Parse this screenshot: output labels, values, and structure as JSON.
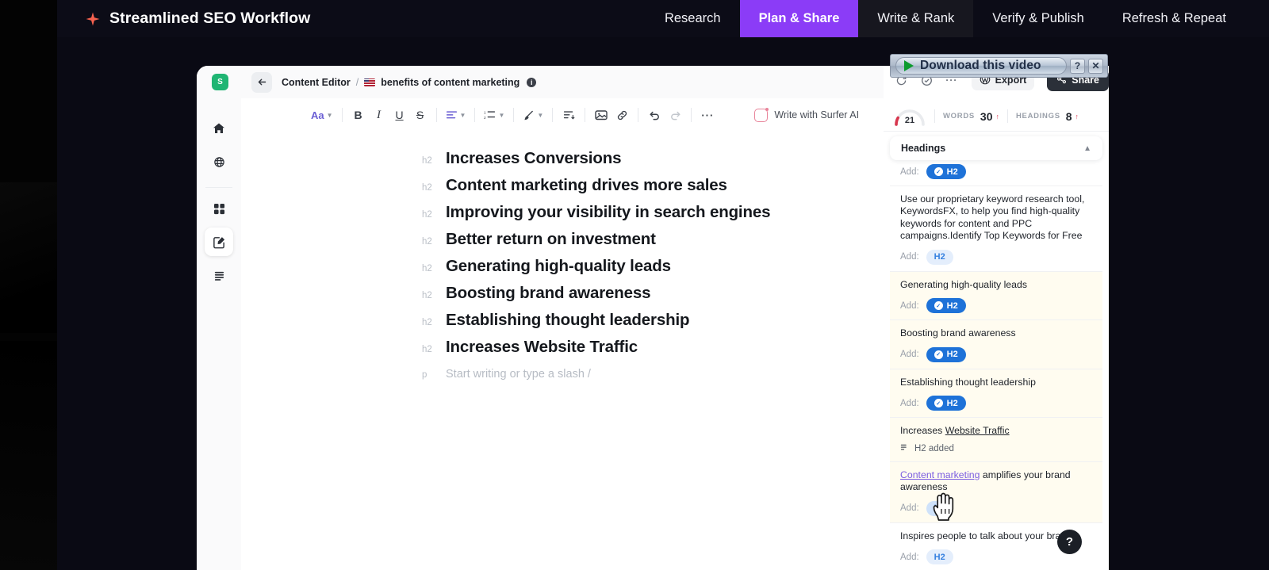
{
  "topnav": {
    "brand_title": "Streamlined SEO Workflow",
    "brand_icon": "sparkle-icon",
    "accent_color": "#8b3cf7",
    "brand_icon_color": "#f4614f",
    "tabs": [
      {
        "label": "Research",
        "active": false
      },
      {
        "label": "Plan & Share",
        "active": true
      },
      {
        "label": "Write & Rank",
        "active": false
      },
      {
        "label": "Verify & Publish",
        "active": false
      },
      {
        "label": "Refresh & Repeat",
        "active": false
      }
    ]
  },
  "app": {
    "logo_letter": "S",
    "breadcrumb": {
      "root": "Content Editor",
      "separator": "/",
      "flag": "us-flag-icon",
      "current": "benefits of content marketing",
      "info": "i"
    },
    "rail": [
      {
        "name": "home-icon"
      },
      {
        "name": "globe-icon"
      },
      {
        "name": "grid-icon"
      },
      {
        "name": "content-editor-icon",
        "active": true
      },
      {
        "name": "list-icon"
      }
    ]
  },
  "toolbar": {
    "font_size_label": "Aa",
    "bold": "B",
    "italic": "I",
    "underline": "U",
    "strikethrough": "S",
    "align": "align-icon",
    "ordered_list": "ordered-list-icon",
    "highlight": "brush-icon",
    "indent": "indent-icon",
    "image": "image-icon",
    "link": "link-icon",
    "undo": "undo-icon",
    "redo": "redo-icon",
    "more": "···",
    "ai_label": "Write with Surfer AI"
  },
  "document": {
    "blocks": [
      {
        "tag": "h2",
        "text": "Increases Conversions"
      },
      {
        "tag": "h2",
        "text": "Content marketing drives more sales"
      },
      {
        "tag": "h2",
        "text": "Improving your visibility in search engines"
      },
      {
        "tag": "h2",
        "text": "Better return on investment"
      },
      {
        "tag": "h2",
        "text": "Generating high-quality leads"
      },
      {
        "tag": "h2",
        "text": "Boosting brand awareness"
      },
      {
        "tag": "h2",
        "text": "Establishing thought leadership"
      },
      {
        "tag": "h2",
        "text": "Increases Website Traffic"
      }
    ],
    "empty_tag": "p",
    "empty_placeholder": "Start writing or type a slash /"
  },
  "panel": {
    "actions": {
      "refresh": "refresh-icon",
      "check": "check-circle-icon",
      "more": "···",
      "export_label": "Export",
      "export_icon": "wordpress-icon",
      "share_label": "Share",
      "share_icon": "share-icon"
    },
    "stats": {
      "score_value": "21",
      "words_label": "WORDS",
      "words_value": "30",
      "words_arrow": "↑",
      "headings_label": "HEADINGS",
      "headings_value": "8",
      "headings_arrow": "↑",
      "score_color": "#d8374e"
    },
    "section": {
      "title": "Headings",
      "collapse_icon": "chevron-up-icon"
    },
    "add_label": "Add:",
    "pill_label": "H2",
    "added_label": "H2 added",
    "items": [
      {
        "text": "",
        "state": "on",
        "highlight": false,
        "partial": true
      },
      {
        "text": "Use our proprietary keyword research tool, KeywordsFX, to help you find high-quality keywords for content and PPC campaigns.Identify Top Keywords for Free",
        "state": "off",
        "highlight": false
      },
      {
        "text": "Generating high-quality leads",
        "state": "on",
        "highlight": true
      },
      {
        "text": "Boosting brand awareness",
        "state": "on",
        "highlight": true
      },
      {
        "text": "Establishing thought leadership",
        "state": "on",
        "highlight": true
      },
      {
        "text": "Increases Website Traffic",
        "state": "added",
        "highlight": true,
        "underline_from": 10
      },
      {
        "text": "Content marketing amplifies your brand awareness",
        "state": "hover",
        "highlight": true,
        "link_prefix": "Content marketing"
      },
      {
        "text": "Inspires people to talk about your brand",
        "state": "off",
        "highlight": false
      }
    ],
    "help_label": "?"
  },
  "overlay": {
    "download_label": "Download this video",
    "play_icon": "play-icon",
    "help_btn": "?",
    "close_btn": "✕"
  }
}
